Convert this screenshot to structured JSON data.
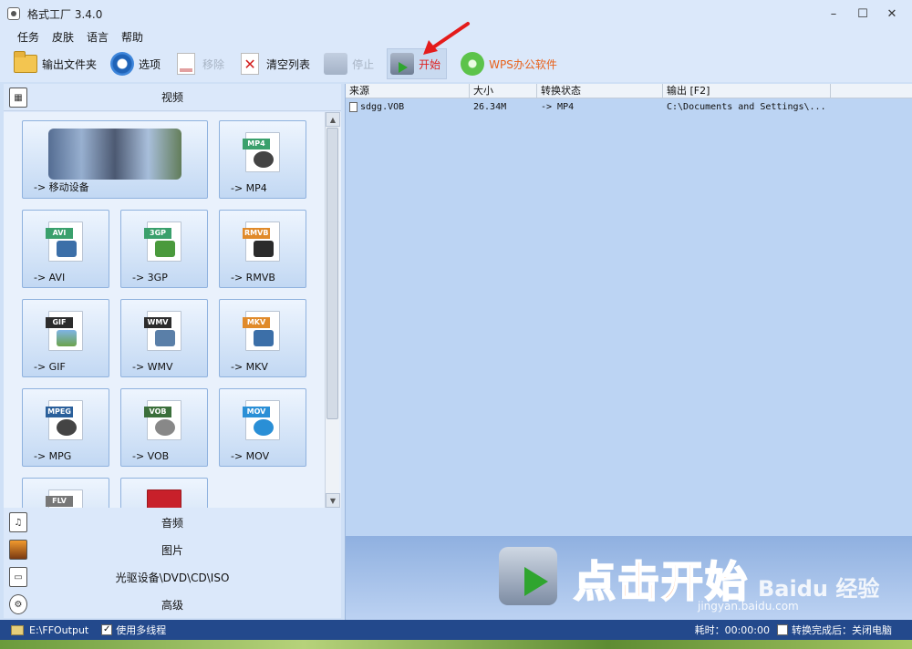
{
  "window": {
    "title": "格式工厂 3.4.0",
    "buttons": [
      "–",
      "☐",
      "✕"
    ]
  },
  "menu": [
    "任务",
    "皮肤",
    "语言",
    "帮助"
  ],
  "toolbar": {
    "output_folder": "输出文件夹",
    "options": "选项",
    "remove": "移除",
    "clear_list": "清空列表",
    "stop": "停止",
    "start": "开始",
    "wps": "WPS办公软件"
  },
  "left": {
    "video_label": "视频",
    "tiles": [
      {
        "label": "-> 移动设备",
        "tag": "",
        "tag_color": ""
      },
      {
        "label": "-> MP4",
        "tag": "MP4",
        "tag_color": "#3aa06c"
      },
      {
        "label": "-> AVI",
        "tag": "AVI",
        "tag_color": "#3aa06c"
      },
      {
        "label": "-> 3GP",
        "tag": "3GP",
        "tag_color": "#3aa06c"
      },
      {
        "label": "-> RMVB",
        "tag": "RMVB",
        "tag_color": "#e08a2a"
      },
      {
        "label": "-> GIF",
        "tag": "GIF",
        "tag_color": "#2c2c2c"
      },
      {
        "label": "-> WMV",
        "tag": "WMV",
        "tag_color": "#2c2c2c"
      },
      {
        "label": "-> MKV",
        "tag": "MKV",
        "tag_color": "#e08a2a"
      },
      {
        "label": "-> MPG",
        "tag": "MPEG",
        "tag_color": "#2a5f9a"
      },
      {
        "label": "-> VOB",
        "tag": "VOB",
        "tag_color": "#3b6f3b"
      },
      {
        "label": "-> MOV",
        "tag": "MOV",
        "tag_color": "#2a8fd6"
      },
      {
        "label": "",
        "tag": "FLV",
        "tag_color": "#777777"
      },
      {
        "label": "",
        "tag": "",
        "tag_color": "#c8202a"
      }
    ],
    "categories": [
      {
        "label": "音频",
        "icon": "music-icon"
      },
      {
        "label": "图片",
        "icon": "picture-icon"
      },
      {
        "label": "光驱设备\\DVD\\CD\\ISO",
        "icon": "disc-drive-icon"
      },
      {
        "label": "高级",
        "icon": "film-reel-icon"
      }
    ]
  },
  "table": {
    "columns": [
      "来源",
      "大小",
      "转换状态",
      "输出 [F2]"
    ],
    "rows": [
      {
        "source": "sdgg.VOB",
        "size": "26.34M",
        "status": "-> MP4",
        "output": "C:\\Documents and Settings\\..."
      }
    ]
  },
  "start_banner": {
    "text": "点击开始",
    "watermark": "Baidu 经验",
    "watermark_url": "jingyan.baidu.com"
  },
  "status": {
    "output_path": "E:\\FFOutput",
    "multithread": "使用多线程",
    "elapsed": "耗时：00:00:00",
    "after_convert": "转换完成后：关闭电脑"
  }
}
